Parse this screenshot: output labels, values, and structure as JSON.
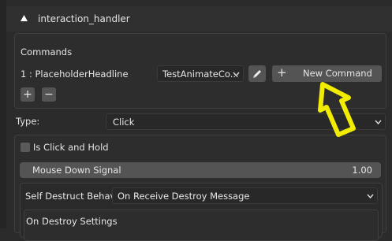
{
  "panel": {
    "title": "interaction_handler",
    "commands_label": "Commands",
    "command_entry": "1 : PlaceholderHeadline",
    "command_dropdown_value": "TestAnimateCo...",
    "new_command_label": "New Command",
    "add_symbol": "+",
    "remove_symbol": "−",
    "new_command_plus": "+"
  },
  "fields": {
    "type_label": "Type:",
    "type_value": "Click",
    "is_click_and_hold_label": "Is Click and Hold",
    "is_click_and_hold_checked": false,
    "mouse_down_signal_label": "Mouse Down Signal",
    "mouse_down_signal_value": "1.00",
    "self_destruct_label": "Self Destruct Behavi...",
    "self_destruct_value": "On Receive Destroy Message",
    "on_destroy_settings_label": "On Destroy Settings"
  },
  "colors": {
    "background": "#2b2b2b",
    "button": "#545454",
    "arrow_annotation": "#f2ec00"
  }
}
